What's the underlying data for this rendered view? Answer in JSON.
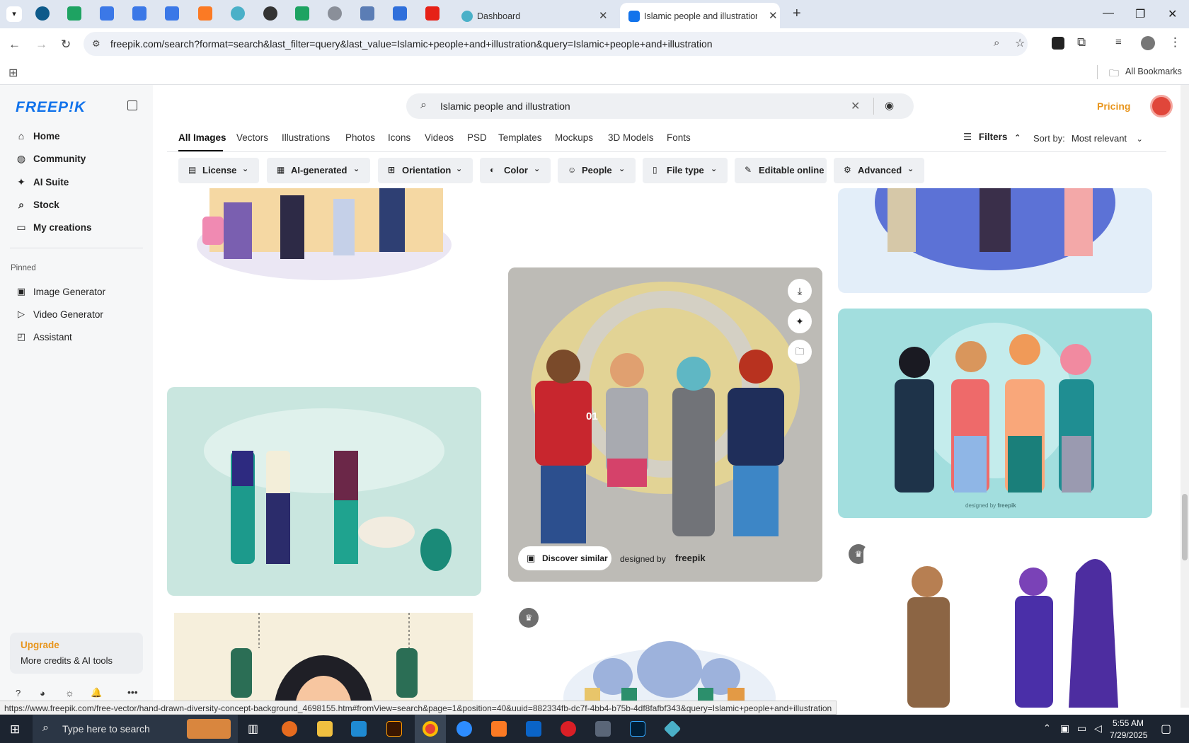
{
  "browser": {
    "tabs": [
      {
        "title": "Dashboard"
      },
      {
        "title": "Islamic people and illustration vec"
      }
    ],
    "url": "freepik.com/search?format=search&last_filter=query&last_value=Islamic+people+and+illustration&query=Islamic+people+and+illustration",
    "bookmarks_label": "All Bookmarks",
    "status_url": "https://www.freepik.com/free-vector/hand-drawn-diversity-concept-background_4698155.htm#fromView=search&page=1&position=40&uuid=882334fb-dc7f-4bb4-b75b-4df8fafbf343&query=Islamic+people+and+illustration"
  },
  "sidebar": {
    "logo": "FREEP!K",
    "nav": [
      {
        "label": "Home",
        "icon": "home-icon"
      },
      {
        "label": "Community",
        "icon": "globe-icon"
      },
      {
        "label": "AI Suite",
        "icon": "sparkle-icon"
      },
      {
        "label": "Stock",
        "icon": "search-icon"
      },
      {
        "label": "My creations",
        "icon": "folder-icon"
      }
    ],
    "pinned_label": "Pinned",
    "pinned": [
      {
        "label": "Image Generator",
        "icon": "image-icon"
      },
      {
        "label": "Video Generator",
        "icon": "video-icon"
      },
      {
        "label": "Assistant",
        "icon": "chat-icon"
      }
    ],
    "upgrade": {
      "title": "Upgrade",
      "subtitle": "More credits & AI tools"
    }
  },
  "header": {
    "search_value": "Islamic people and illustration",
    "pricing_label": "Pricing"
  },
  "type_tabs": [
    "All Images",
    "Vectors",
    "Illustrations",
    "Photos",
    "Icons",
    "Videos",
    "PSD",
    "Templates",
    "Mockups",
    "3D Models",
    "Fonts"
  ],
  "active_tab": "All Images",
  "filters_label": "Filters",
  "sort": {
    "label": "Sort by:",
    "value": "Most relevant"
  },
  "filter_chips": [
    {
      "label": "License",
      "dropdown": true
    },
    {
      "label": "AI-generated",
      "dropdown": true
    },
    {
      "label": "Orientation",
      "dropdown": true
    },
    {
      "label": "Color",
      "dropdown": true
    },
    {
      "label": "People",
      "dropdown": true
    },
    {
      "label": "File type",
      "dropdown": true
    },
    {
      "label": "Editable online",
      "dropdown": false
    },
    {
      "label": "Advanced",
      "dropdown": true
    }
  ],
  "featured_card": {
    "discover_label": "Discover similar",
    "credit_prefix": "designed by",
    "credit_brand": "freepik",
    "shirt_number": "01"
  },
  "card_credit": "designed by",
  "card_credit_brand": "freepik",
  "taskbar": {
    "search_placeholder": "Type here to search",
    "time": "5:55 AM",
    "date": "7/29/2025"
  },
  "colors": {
    "accent": "#1273eb",
    "pricing": "#e8951c",
    "upgrade": "#e8951c"
  }
}
